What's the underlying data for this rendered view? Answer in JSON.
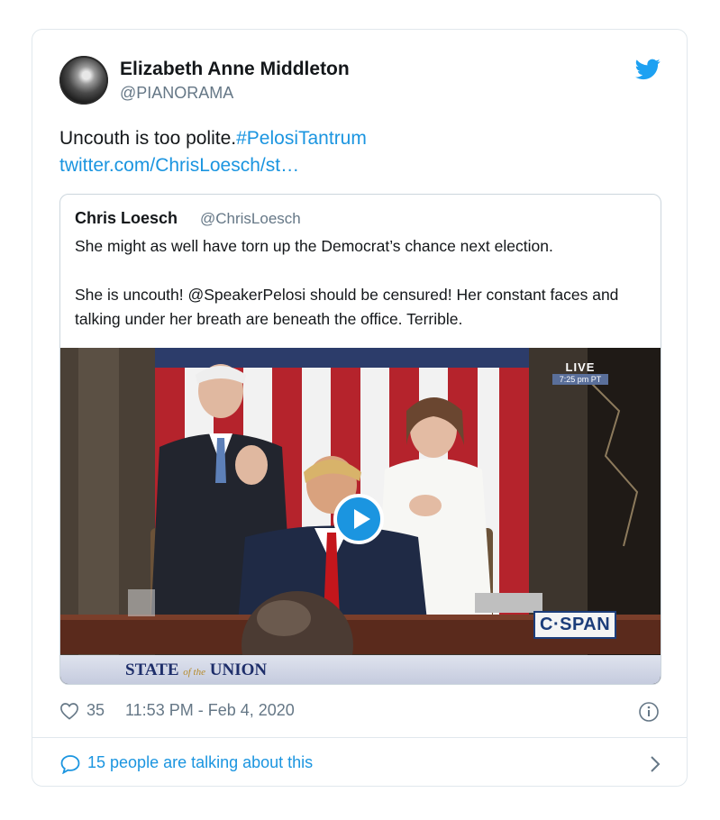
{
  "author": {
    "name": "Elizabeth Anne Middleton",
    "handle": "@PIANORAMA"
  },
  "tweet": {
    "text": "Uncouth is too polite.",
    "hashtag": "#PelosiTantrum",
    "link": "twitter.com/ChrisLoesch/st…"
  },
  "quoted": {
    "name": "Chris Loesch",
    "handle": "@ChrisLoesch",
    "paragraph1": "She might as well have torn up the Democrat’s chance next election.",
    "paragraph2": "She is uncouth! @SpeakerPelosi should be censured! Her constant faces and talking under her breath are beneath the office. Terrible.",
    "media": {
      "live_label": "LIVE",
      "live_time": "7:25 pm PT",
      "network": "C·SPAN",
      "banner_state": "STATE",
      "banner_of_the": "of the",
      "banner_union": "UNION"
    }
  },
  "meta": {
    "likes": "35",
    "timestamp": "11:53 PM - Feb 4, 2020"
  },
  "conversation": {
    "text": "15 people are talking about this"
  },
  "colors": {
    "link": "#1b95e0",
    "secondary_text": "#657786",
    "border": "#e1e8ed"
  },
  "icons": [
    "twitter-bird-icon",
    "heart-icon",
    "info-icon",
    "comment-icon",
    "chevron-right-icon",
    "play-icon"
  ]
}
